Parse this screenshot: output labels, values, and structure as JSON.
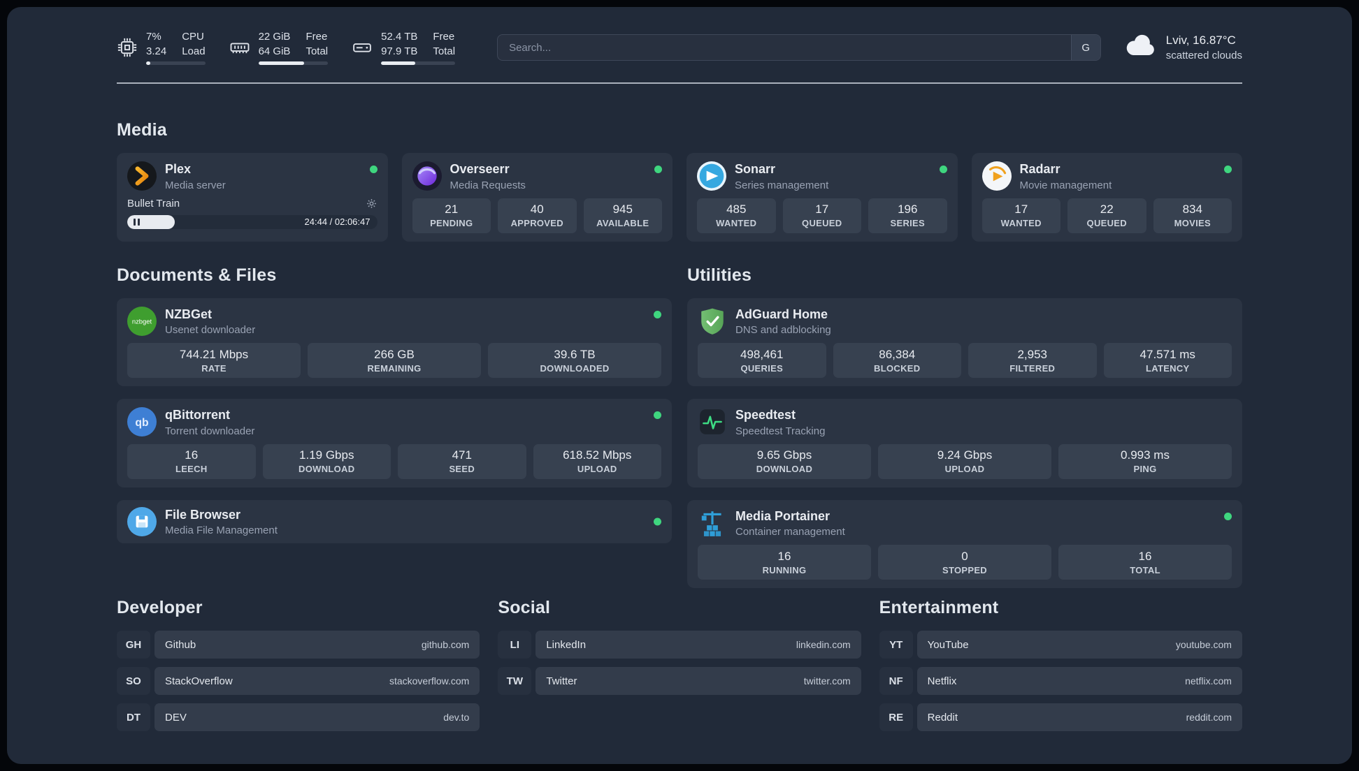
{
  "colors": {
    "page_bg": "#212a39",
    "card_bg": "#2b3443",
    "stat_bg": "#374150",
    "status_dot": "#3fd67f",
    "accent_green": "#3ddc84"
  },
  "topbar": {
    "cpu": {
      "icon": "cpu-chip-icon",
      "value_top": "7%",
      "value_bottom": "3.24",
      "label_top": "CPU",
      "label_bottom": "Load",
      "bar_width": "7%"
    },
    "memory": {
      "icon": "memory-icon",
      "value_top": "22 GiB",
      "value_bottom": "64 GiB",
      "label_top": "Free",
      "label_bottom": "Total",
      "bar_width": "66%"
    },
    "disk": {
      "icon": "hard-drive-icon",
      "value_top": "52.4 TB",
      "value_bottom": "97.9 TB",
      "label_top": "Free",
      "label_bottom": "Total",
      "bar_width": "46%"
    },
    "search": {
      "placeholder": "Search...",
      "button_label": "G"
    },
    "weather": {
      "icon": "cloud-icon",
      "location": "Lviv, 16.87°C",
      "condition": "scattered clouds"
    }
  },
  "sections": {
    "media": "Media",
    "documents": "Documents & Files",
    "utilities": "Utilities",
    "developer": "Developer",
    "social": "Social",
    "entertainment": "Entertainment"
  },
  "services": {
    "plex": {
      "icon": "plex-icon",
      "name": "Plex",
      "subtitle": "Media server",
      "player": {
        "track": "Bullet Train",
        "time": "24:44 / 02:06:47",
        "progress_width": "19%"
      }
    },
    "overseerr": {
      "icon": "overseerr-icon",
      "name": "Overseerr",
      "subtitle": "Media Requests",
      "stats": [
        {
          "value": "21",
          "label": "PENDING"
        },
        {
          "value": "40",
          "label": "APPROVED"
        },
        {
          "value": "945",
          "label": "AVAILABLE"
        }
      ]
    },
    "sonarr": {
      "icon": "sonarr-icon",
      "name": "Sonarr",
      "subtitle": "Series management",
      "stats": [
        {
          "value": "485",
          "label": "WANTED"
        },
        {
          "value": "17",
          "label": "QUEUED"
        },
        {
          "value": "196",
          "label": "SERIES"
        }
      ]
    },
    "radarr": {
      "icon": "radarr-icon",
      "name": "Radarr",
      "subtitle": "Movie management",
      "stats": [
        {
          "value": "17",
          "label": "WANTED"
        },
        {
          "value": "22",
          "label": "QUEUED"
        },
        {
          "value": "834",
          "label": "MOVIES"
        }
      ]
    },
    "nzbget": {
      "icon": "nzbget-icon",
      "name": "NZBGet",
      "subtitle": "Usenet downloader",
      "stats": [
        {
          "value": "744.21 Mbps",
          "label": "RATE"
        },
        {
          "value": "266 GB",
          "label": "REMAINING"
        },
        {
          "value": "39.6 TB",
          "label": "DOWNLOADED"
        }
      ]
    },
    "qbittorrent": {
      "icon": "qbittorrent-icon",
      "name": "qBittorrent",
      "subtitle": "Torrent downloader",
      "stats": [
        {
          "value": "16",
          "label": "LEECH"
        },
        {
          "value": "1.19 Gbps",
          "label": "DOWNLOAD"
        },
        {
          "value": "471",
          "label": "SEED"
        },
        {
          "value": "618.52 Mbps",
          "label": "UPLOAD"
        }
      ]
    },
    "filebrowser": {
      "icon": "filebrowser-icon",
      "name": "File Browser",
      "subtitle": "Media File Management"
    },
    "adguard": {
      "icon": "adguard-icon",
      "name": "AdGuard Home",
      "subtitle": "DNS and adblocking",
      "stats": [
        {
          "value": "498,461",
          "label": "QUERIES"
        },
        {
          "value": "86,384",
          "label": "BLOCKED"
        },
        {
          "value": "2,953",
          "label": "FILTERED"
        },
        {
          "value": "47.571 ms",
          "label": "LATENCY"
        }
      ]
    },
    "speedtest": {
      "icon": "speedtest-icon",
      "name": "Speedtest",
      "subtitle": "Speedtest Tracking",
      "stats": [
        {
          "value": "9.65 Gbps",
          "label": "DOWNLOAD"
        },
        {
          "value": "9.24 Gbps",
          "label": "UPLOAD"
        },
        {
          "value": "0.993 ms",
          "label": "PING"
        }
      ]
    },
    "portainer": {
      "icon": "portainer-icon",
      "name": "Media Portainer",
      "subtitle": "Container management",
      "stats": [
        {
          "value": "16",
          "label": "RUNNING"
        },
        {
          "value": "0",
          "label": "STOPPED"
        },
        {
          "value": "16",
          "label": "TOTAL"
        }
      ]
    }
  },
  "bookmarks": {
    "developer": [
      {
        "abbr": "GH",
        "name": "Github",
        "url": "github.com"
      },
      {
        "abbr": "SO",
        "name": "StackOverflow",
        "url": "stackoverflow.com"
      },
      {
        "abbr": "DT",
        "name": "DEV",
        "url": "dev.to"
      }
    ],
    "social": [
      {
        "abbr": "LI",
        "name": "LinkedIn",
        "url": "linkedin.com"
      },
      {
        "abbr": "TW",
        "name": "Twitter",
        "url": "twitter.com"
      }
    ],
    "entertainment": [
      {
        "abbr": "YT",
        "name": "YouTube",
        "url": "youtube.com"
      },
      {
        "abbr": "NF",
        "name": "Netflix",
        "url": "netflix.com"
      },
      {
        "abbr": "RE",
        "name": "Reddit",
        "url": "reddit.com"
      }
    ]
  }
}
